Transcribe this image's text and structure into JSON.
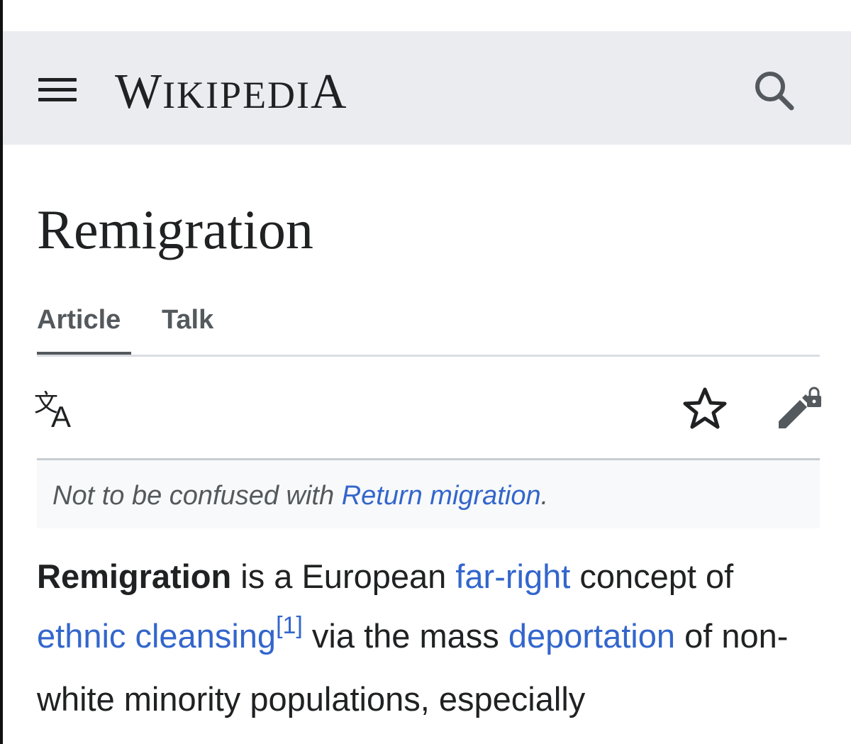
{
  "header": {
    "logo_first": "W",
    "logo_mid": "IKIPEDI",
    "logo_last": "A",
    "menu_icon": "hamburger-menu-icon",
    "search_icon": "search-icon"
  },
  "page": {
    "title": "Remigration"
  },
  "tabs": [
    {
      "label": "Article",
      "active": true
    },
    {
      "label": "Talk",
      "active": false
    }
  ],
  "toolbar": {
    "language_icon": "language-icon",
    "watch_icon": "star-icon",
    "edit_icon": "edit-locked-icon"
  },
  "hatnote": {
    "prefix": "Not to be confused with ",
    "link": "Return migration",
    "suffix": "."
  },
  "body": {
    "bold_term": "Remigration",
    "text1": " is a European ",
    "link1": "far-right",
    "text2": " concept of ",
    "link2": "ethnic cleansing",
    "ref": "[1]",
    "text3": " via the mass ",
    "link3": "deportation",
    "text4": " of non-white minority populations, especially"
  },
  "colors": {
    "header_bg": "#eaecf0",
    "link": "#3366cc",
    "text": "#202122",
    "tab": "#54595d",
    "hatnote_bg": "#f8f9fa"
  }
}
